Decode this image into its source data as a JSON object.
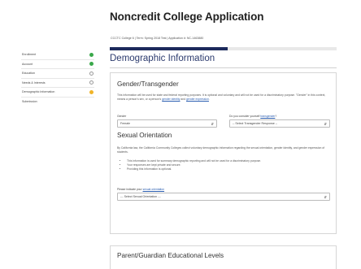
{
  "sidebar": {
    "items": [
      {
        "label": "Enrollment",
        "status": "green"
      },
      {
        "label": "Account",
        "status": "green"
      },
      {
        "label": "Education",
        "status": "outline"
      },
      {
        "label": "Needs & Interests",
        "status": "outline"
      },
      {
        "label": "Demographic Information",
        "status": "yellow"
      },
      {
        "label": "Submission",
        "status": "none"
      }
    ]
  },
  "header": {
    "title": "Noncredit College Application",
    "subtitle": "CCCTC College 6 | Term: Spring 2018 Test | Application #: NC-1463880",
    "progress": 0.52,
    "page_title": "Demographic Information"
  },
  "gender": {
    "title": "Gender/Transgender",
    "intro": "This information will be used for state and federal reporting purposes. It is optional and voluntary and will not be used for a discriminatory purpose. \"Gender\" in this context, means a person's sex, or a person's",
    "link1": "gender identity",
    "and_text": "and",
    "link2": "gender expression",
    "gender_label": "Gender",
    "gender_value": "Female",
    "trans_label": "Do you consider yourself",
    "trans_link": "transgender",
    "trans_value": "-- Select Transgender Response --"
  },
  "orientation": {
    "title": "Sexual Orientation",
    "intro": "By California law, the California Community Colleges collect voluntary demographic information regarding the sexual orientation, gender identity, and gender expression of students.",
    "bullets": [
      "This information is used for summary demographic reporting and will not be used for a discriminatory purpose.",
      "Your responses are kept private and secure.",
      "Providing this information is optional."
    ],
    "prompt": "Please indicate your",
    "prompt_link": "sexual orientation",
    "select_value": "--- Select Sexual Orientation ---"
  },
  "parent": {
    "title": "Parent/Guardian Educational Levels"
  }
}
